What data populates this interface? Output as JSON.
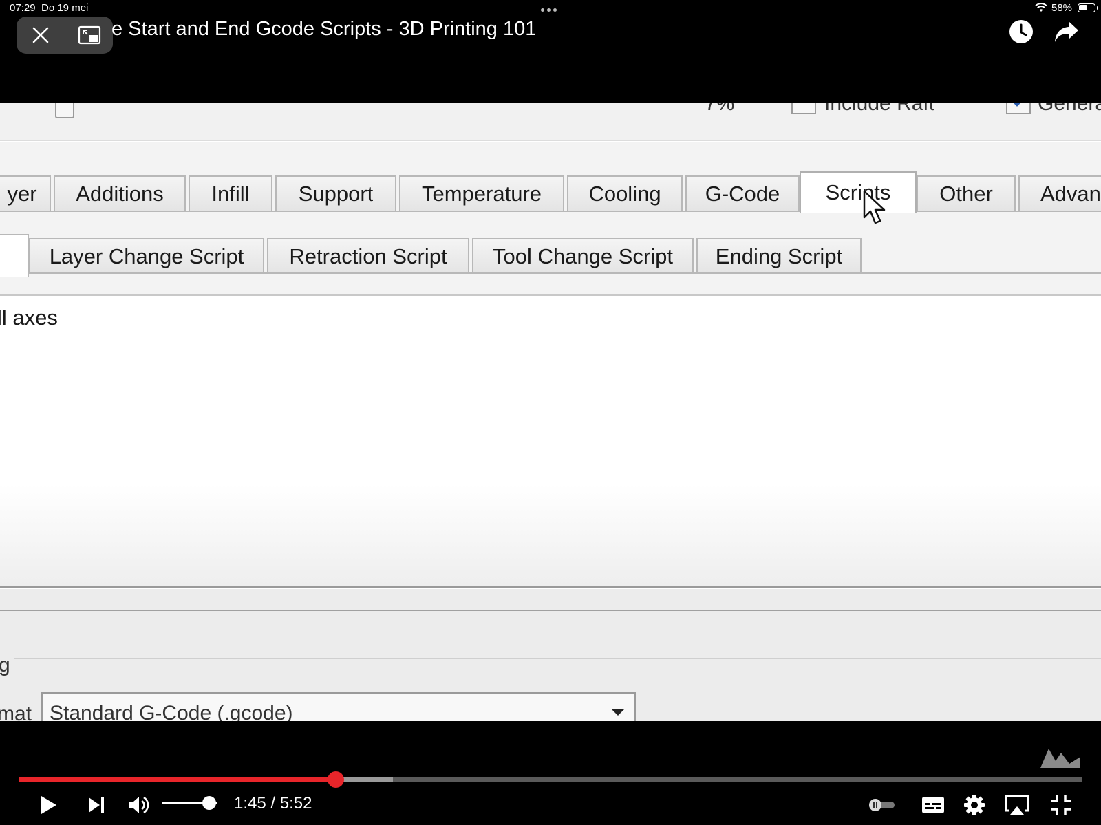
{
  "status_bar": {
    "time": "07:29",
    "date": "Do 19 mei",
    "battery": "58%"
  },
  "overlay": {
    "title": "e Start and End Gcode Scripts - 3D Printing 101",
    "close_icon": "close-icon",
    "pip_icon": "picture-in-picture-icon",
    "watch_later_icon": "clock-icon",
    "share_icon": "share-arrow-icon"
  },
  "video_frame": {
    "top_cut": {
      "percent": "7%",
      "raft_label": "Include Raft",
      "generate_label": "Genera"
    },
    "tabs": [
      {
        "label": "yer",
        "active": false
      },
      {
        "label": "Additions",
        "active": false
      },
      {
        "label": "Infill",
        "active": false
      },
      {
        "label": "Support",
        "active": false
      },
      {
        "label": "Temperature",
        "active": false
      },
      {
        "label": "Cooling",
        "active": false
      },
      {
        "label": "G-Code",
        "active": false
      },
      {
        "label": "Scripts",
        "active": true
      },
      {
        "label": "Other",
        "active": false
      },
      {
        "label": "Advan",
        "active": false
      }
    ],
    "subtabs": [
      {
        "label": "Layer Change Script"
      },
      {
        "label": "Retraction Script"
      },
      {
        "label": "Tool Change Script"
      },
      {
        "label": "Ending Script"
      }
    ],
    "script_line": "ll axes",
    "lower_label": "g",
    "format_label": "mat",
    "format_select_value": "Standard G-Code (.gcode)"
  },
  "player": {
    "current_time": "1:45",
    "duration": "5:52",
    "time_separator": " / ",
    "played_fraction": 0.298,
    "buffered_fraction": 0.352,
    "volume_fraction": 0.85,
    "accent_color": "#e8252a",
    "controls": [
      "play-icon",
      "next-icon",
      "volume-icon",
      "autoplay-toggle-icon",
      "captions-icon",
      "settings-gear-icon",
      "airplay-icon",
      "exit-fullscreen-icon"
    ]
  }
}
